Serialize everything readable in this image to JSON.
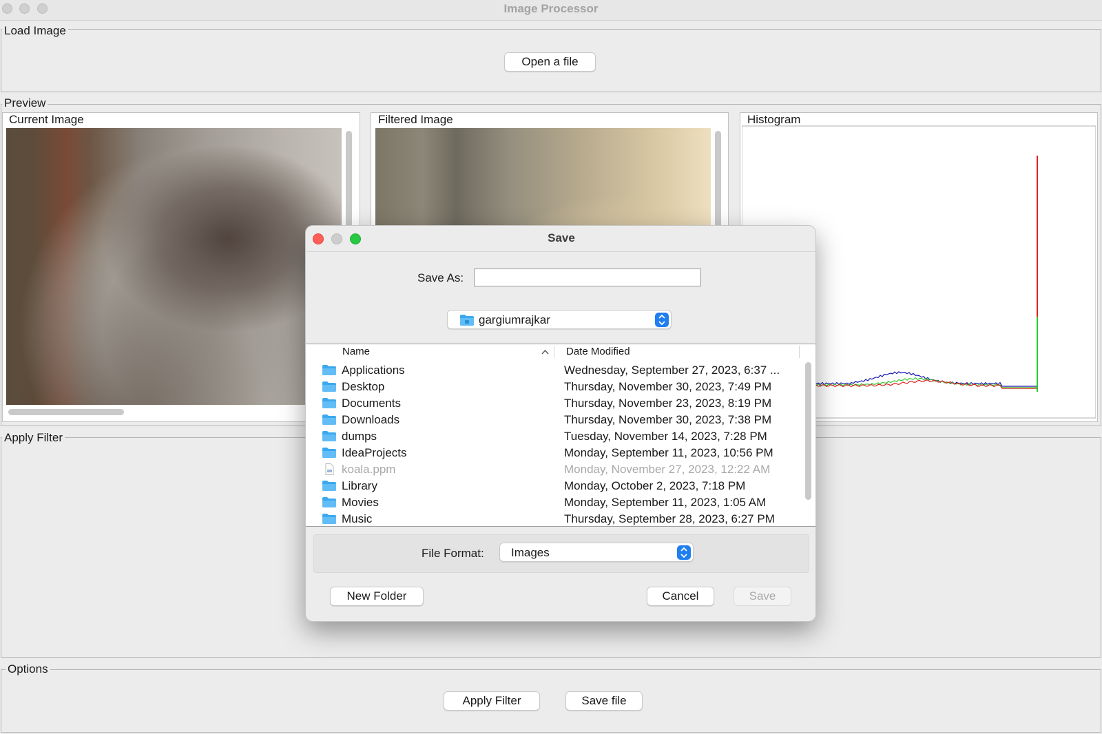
{
  "window": {
    "title": "Image Processor"
  },
  "load_image": {
    "group_label": "Load Image",
    "open_button": "Open a file"
  },
  "preview": {
    "group_label": "Preview",
    "current_image_label": "Current Image",
    "filtered_image_label": "Filtered Image",
    "histogram_label": "Histogram",
    "histogram_colors": {
      "red": "#e02020",
      "green": "#2ec82e",
      "blue": "#1515b0"
    }
  },
  "apply_filter": {
    "group_label": "Apply Filter"
  },
  "options": {
    "group_label": "Options",
    "apply_button": "Apply Filter",
    "save_button": "Save file"
  },
  "dialog": {
    "title": "Save",
    "save_as_label": "Save As:",
    "save_as_value": "",
    "location": "gargiumrajkar",
    "columns": {
      "name": "Name",
      "date": "Date Modified"
    },
    "files": [
      {
        "name": "Applications",
        "date": "Wednesday, September 27, 2023, 6:37 ...",
        "icon": "applications-folder-icon"
      },
      {
        "name": "Desktop",
        "date": "Thursday, November 30, 2023, 7:49 PM",
        "icon": "desktop-folder-icon"
      },
      {
        "name": "Documents",
        "date": "Thursday, November 23, 2023, 8:19 PM",
        "icon": "documents-folder-icon"
      },
      {
        "name": "Downloads",
        "date": "Thursday, November 30, 2023, 7:38 PM",
        "icon": "downloads-folder-icon"
      },
      {
        "name": "dumps",
        "date": "Tuesday, November 14, 2023, 7:28 PM",
        "icon": "folder-icon"
      },
      {
        "name": "IdeaProjects",
        "date": "Monday, September 11, 2023, 10:56 PM",
        "icon": "folder-icon"
      },
      {
        "name": "koala.ppm",
        "date": "Monday, November 27, 2023, 12:22 AM",
        "icon": "file-icon",
        "disabled": true
      },
      {
        "name": "Library",
        "date": "Monday, October 2, 2023, 7:18 PM",
        "icon": "library-folder-icon"
      },
      {
        "name": "Movies",
        "date": "Monday, September 11, 2023, 1:05 AM",
        "icon": "movies-folder-icon"
      },
      {
        "name": "Music",
        "date": "Thursday, September 28, 2023, 6:27 PM",
        "icon": "music-folder-icon"
      }
    ],
    "file_format_label": "File Format:",
    "file_format_value": "Images",
    "new_folder_button": "New Folder",
    "cancel_button": "Cancel",
    "save_button": "Save",
    "accent_color": "#1f7ef0",
    "traffic_lights": {
      "close": "#ff5f57",
      "minimize": "#cdcdcd",
      "zoom": "#28c840"
    }
  }
}
